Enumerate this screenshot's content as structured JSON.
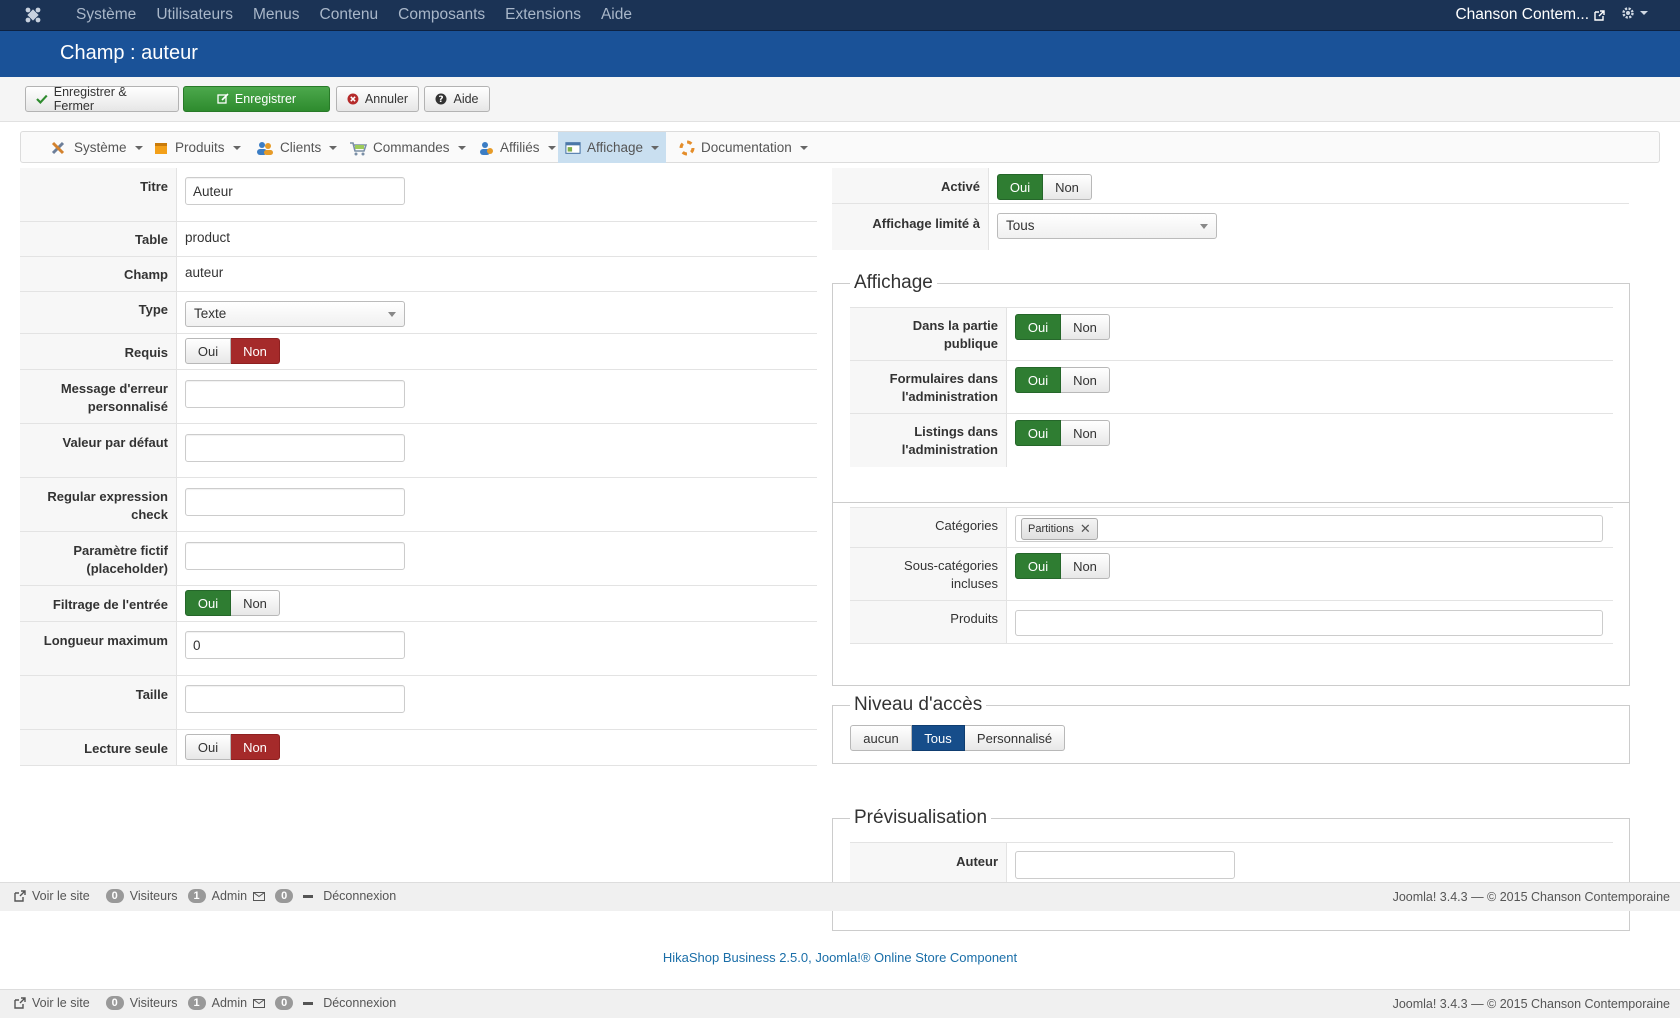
{
  "topnav": {
    "menu": [
      "Système",
      "Utilisateurs",
      "Menus",
      "Contenu",
      "Composants",
      "Extensions",
      "Aide"
    ],
    "site_name": "Chanson Contem..."
  },
  "header": {
    "title": "Champ : auteur"
  },
  "toolbar": {
    "save_close": "Enregistrer & Fermer",
    "save": "Enregistrer",
    "cancel": "Annuler",
    "help": "Aide"
  },
  "submenu": [
    "Système",
    "Produits",
    "Clients",
    "Commandes",
    "Affiliés",
    "Affichage",
    "Documentation"
  ],
  "form": {
    "titre_label": "Titre",
    "titre_value": "Auteur",
    "table_label": "Table",
    "table_value": "product",
    "champ_label": "Champ",
    "champ_value": "auteur",
    "type_label": "Type",
    "type_value": "Texte",
    "requis_label": "Requis",
    "message_label_1": "Message d'erreur",
    "message_label_2": "personnalisé",
    "defaut_label": "Valeur par défaut",
    "regex_label_1": "Regular expression",
    "regex_label_2": "check",
    "placeholder_label_1": "Paramètre fictif",
    "placeholder_label_2": "(placeholder)",
    "filtrage_label": "Filtrage de l'entrée",
    "longueur_label": "Longueur maximum",
    "longueur_value": "0",
    "taille_label": "Taille",
    "lecture_label": "Lecture seule",
    "oui": "Oui",
    "non": "Non"
  },
  "right": {
    "active_label": "Activé",
    "limite_label": "Affichage limité à",
    "limite_value": "Tous",
    "affichage_legend": "Affichage",
    "public_label_1": "Dans la partie",
    "public_label_2": "publique",
    "forms_label_1": "Formulaires dans",
    "forms_label_2": "l'administration",
    "listings_label_1": "Listings dans",
    "listings_label_2": "l'administration",
    "categories_label": "Catégories",
    "categories_tag": "Partitions",
    "souscat_label_1": "Sous-catégories",
    "souscat_label_2": "incluses",
    "produits_label": "Produits",
    "acces_legend": "Niveau d'accès",
    "acces_options": [
      "aucun",
      "Tous",
      "Personnalisé"
    ],
    "preview_legend": "Prévisualisation",
    "auteur_label": "Auteur"
  },
  "status": {
    "voir": "Voir le site",
    "visiteurs_count": "0",
    "visiteurs": "Visiteurs",
    "admin_count": "1",
    "admin": "Admin",
    "mail_count": "0",
    "deconnexion": "Déconnexion",
    "copyright": "Joomla! 3.4.3  —  © 2015 Chanson Contemporaine"
  },
  "footer": {
    "hikashop": "HikaShop Business 2.5.0, Joomla!® Online Store Component"
  }
}
